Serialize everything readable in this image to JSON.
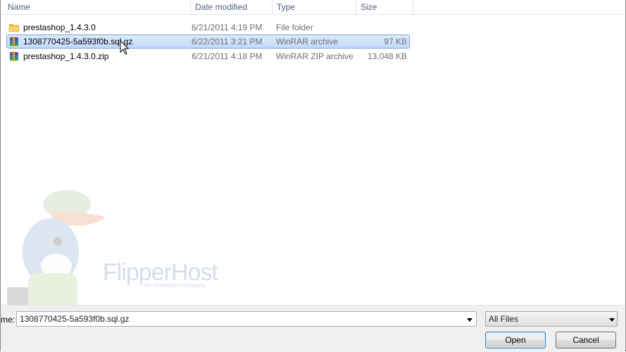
{
  "columns": {
    "name": "Name",
    "date": "Date modified",
    "type": "Type",
    "size": "Size"
  },
  "files": [
    {
      "icon": "folder-icon",
      "name": "prestashop_1.4.3.0",
      "date": "6/21/2011 4:19 PM",
      "type": "File folder",
      "size": "",
      "selected": false
    },
    {
      "icon": "winrar-archive-icon",
      "name": "1308770425-5a593f0b.sql.gz",
      "date": "6/22/2011 3:21 PM",
      "type": "WinRAR archive",
      "size": "97 KB",
      "selected": true
    },
    {
      "icon": "winrar-archive-icon",
      "name": "prestashop_1.4.3.0.zip",
      "date": "6/21/2011 4:18 PM",
      "type": "WinRAR ZIP archive",
      "size": "13,048 KB",
      "selected": false
    }
  ],
  "watermark": {
    "brand": "FlipperHost",
    "tagline": "an investion company",
    "cap_text": "FLIPPER HOST"
  },
  "footer": {
    "filename_label": "me:",
    "filename_value": "1308770425-5a593f0b.sql.gz",
    "filter_value": "All Files",
    "open_label": "Open",
    "cancel_label": "Cancel"
  },
  "colors": {
    "selection": "#c1dbfc",
    "header_text": "#4c607a"
  }
}
